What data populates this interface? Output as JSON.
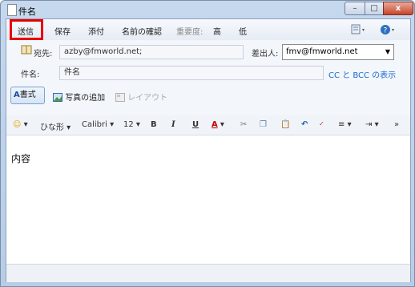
{
  "window": {
    "title": "件名"
  },
  "window_controls": {
    "minimize": "–",
    "maximize": "□",
    "close": "x"
  },
  "toolbar": {
    "send": "送信",
    "save": "保存",
    "attach": "添付",
    "check_names": "名前の確認",
    "priority_label": "重要度:",
    "priority_high": "高",
    "priority_low": "低"
  },
  "header": {
    "to_label": "宛先:",
    "to_value": "azby@fmworld.net;",
    "from_label": "差出人:",
    "from_value": "fmv@fmworld.net",
    "subject_label": "件名:",
    "subject_value": "件名",
    "cc_bcc_link": "CC と BCC の表示"
  },
  "tools": {
    "format": "書式",
    "add_photo": "写真の追加",
    "layout": "レイアウト"
  },
  "format_toolbar": {
    "emoji": "☺",
    "style": "ひな形",
    "font": "Calibri",
    "size": "12",
    "bold": "B",
    "italic": "I",
    "underline": "U",
    "font_color": "A",
    "more": "»"
  },
  "body": {
    "text": "内容"
  },
  "colors": {
    "highlight": "#e60000",
    "link": "#1a6ad1"
  }
}
